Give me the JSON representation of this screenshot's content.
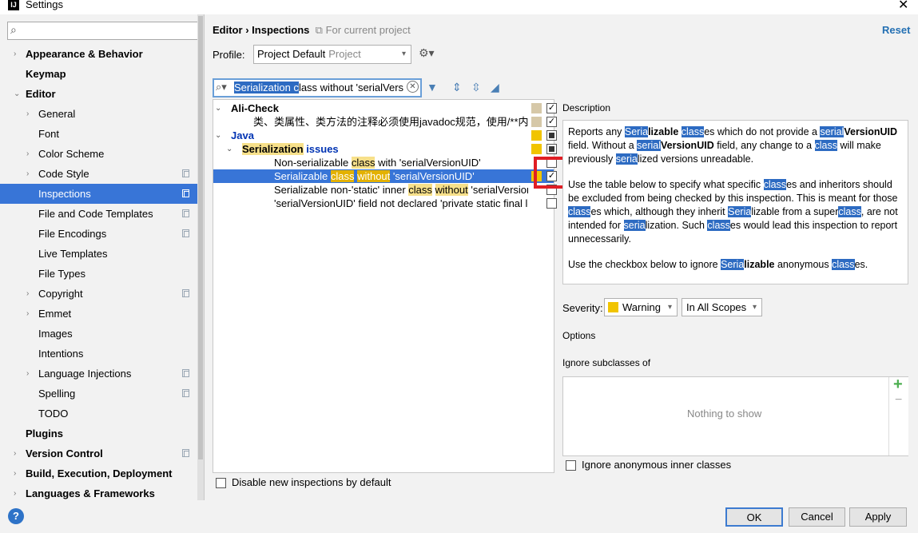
{
  "window": {
    "title": "Settings",
    "app_icon": "intellij-icon"
  },
  "sidebar": {
    "search_placeholder": "",
    "items": [
      {
        "label": "Appearance & Behavior",
        "level": 0,
        "arrow": true,
        "bold": true
      },
      {
        "label": "Keymap",
        "level": 0,
        "arrow": false,
        "bold": true
      },
      {
        "label": "Editor",
        "level": 0,
        "arrow": true,
        "expanded": true,
        "bold": true
      },
      {
        "label": "General",
        "level": 1,
        "arrow": true
      },
      {
        "label": "Font",
        "level": 1
      },
      {
        "label": "Color Scheme",
        "level": 1,
        "arrow": true
      },
      {
        "label": "Code Style",
        "level": 1,
        "arrow": true,
        "copy": true
      },
      {
        "label": "Inspections",
        "level": 1,
        "copy": true,
        "selected": true
      },
      {
        "label": "File and Code Templates",
        "level": 1,
        "copy": true
      },
      {
        "label": "File Encodings",
        "level": 1,
        "copy": true
      },
      {
        "label": "Live Templates",
        "level": 1
      },
      {
        "label": "File Types",
        "level": 1
      },
      {
        "label": "Copyright",
        "level": 1,
        "arrow": true,
        "copy": true
      },
      {
        "label": "Emmet",
        "level": 1,
        "arrow": true
      },
      {
        "label": "Images",
        "level": 1
      },
      {
        "label": "Intentions",
        "level": 1
      },
      {
        "label": "Language Injections",
        "level": 1,
        "arrow": true,
        "copy": true
      },
      {
        "label": "Spelling",
        "level": 1,
        "copy": true
      },
      {
        "label": "TODO",
        "level": 1
      },
      {
        "label": "Plugins",
        "level": 0,
        "bold": true
      },
      {
        "label": "Version Control",
        "level": 0,
        "arrow": true,
        "bold": true,
        "copy": true
      },
      {
        "label": "Build, Execution, Deployment",
        "level": 0,
        "arrow": true,
        "bold": true
      },
      {
        "label": "Languages & Frameworks",
        "level": 0,
        "arrow": true,
        "bold": true
      }
    ]
  },
  "header": {
    "crumb1": "Editor",
    "sep": "›",
    "crumb2": "Inspections",
    "scope_note": "For current project",
    "reset_label": "Reset"
  },
  "profile": {
    "label": "Profile:",
    "value": "Project Default",
    "hint": "Project"
  },
  "filter": {
    "value_highlight": "Serialization c",
    "value_rest": "lass without 'serialVers"
  },
  "inspections": [
    {
      "parts": [
        [
          "Ali-Check",
          false
        ]
      ],
      "level": 0,
      "arrow": true,
      "bold": true,
      "sev": "#d6c8a8",
      "check": "checked"
    },
    {
      "parts": [
        [
          "类、类属性、类方法的注释必须使用javadoc规范，使用/**内容*/格式",
          false
        ]
      ],
      "level": 2,
      "sev": "#d6c8a8",
      "check": "checked"
    },
    {
      "parts": [
        [
          "Java",
          false
        ]
      ],
      "level": 0,
      "arrow": true,
      "bold": true,
      "blue": true,
      "sev": "#f1c400",
      "check": "mixed"
    },
    {
      "parts": [
        [
          "Serialization",
          true
        ],
        [
          " issues",
          false
        ]
      ],
      "level": 1,
      "arrow": true,
      "bold": true,
      "blue": true,
      "sev": "#f1c400",
      "check": "mixed"
    },
    {
      "parts": [
        [
          "Non-serializable ",
          false
        ],
        [
          "class",
          true
        ],
        [
          " with 'serialVersionUID'",
          false
        ]
      ],
      "level": 3,
      "check": "empty"
    },
    {
      "parts": [
        [
          "Serializable ",
          false
        ],
        [
          "class",
          true
        ],
        [
          " ",
          false
        ],
        [
          "without",
          true
        ],
        [
          " 'serialVersionUID'",
          false
        ]
      ],
      "level": 3,
      "selected": true,
      "sev": "#f1c400",
      "check": "checked"
    },
    {
      "parts": [
        [
          "Serializable non-'static' inner ",
          false
        ],
        [
          "class",
          true
        ],
        [
          " ",
          false
        ],
        [
          "without",
          true
        ],
        [
          " 'serialVersionUID'",
          false
        ]
      ],
      "level": 3,
      "check": "empty"
    },
    {
      "parts": [
        [
          "'serialVersionUID' field not declared 'private static final long'",
          false
        ]
      ],
      "level": 3,
      "check": "empty"
    }
  ],
  "disable_new_label": "Disable new inspections by default",
  "description": {
    "label": "Description",
    "p1": [
      [
        "Reports any ",
        0
      ],
      [
        "Seria",
        1
      ],
      [
        "lizable ",
        2
      ],
      [
        "class",
        1
      ],
      [
        "es which do not provide a ",
        0
      ],
      [
        "serial",
        1
      ],
      [
        "VersionUID",
        2
      ],
      [
        " field. Without a ",
        0
      ],
      [
        "serial",
        1
      ],
      [
        "VersionUID",
        2
      ],
      [
        " field, any change to a ",
        0
      ],
      [
        "class",
        1
      ],
      [
        " will make previously ",
        0
      ],
      [
        "seria",
        1
      ],
      [
        "lized versions unreadable.",
        0
      ]
    ],
    "p2": [
      [
        "Use the table below to specify what specific ",
        0
      ],
      [
        "class",
        1
      ],
      [
        "es and inheritors should be excluded from being checked by this inspection. This is meant for those ",
        0
      ],
      [
        "class",
        1
      ],
      [
        "es which, although they inherit ",
        0
      ],
      [
        "Seria",
        1
      ],
      [
        "lizable from a super",
        0
      ],
      [
        "class",
        1
      ],
      [
        ", are not intended for ",
        0
      ],
      [
        "seria",
        1
      ],
      [
        "lization. Such ",
        0
      ],
      [
        "class",
        1
      ],
      [
        "es would lead this inspection to report unnecessarily.",
        0
      ]
    ],
    "p3": [
      [
        "Use the checkbox below to ignore ",
        0
      ],
      [
        "Seria",
        1
      ],
      [
        "lizable",
        2
      ],
      [
        " anonymous ",
        0
      ],
      [
        "class",
        1
      ],
      [
        "es.",
        0
      ]
    ]
  },
  "severity": {
    "label": "Severity:",
    "value": "Warning",
    "color": "#f1c400",
    "scope": "In All Scopes"
  },
  "options_label": "Options",
  "ignore": {
    "label": "Ignore subclasses of",
    "empty": "Nothing to show",
    "add": "+",
    "remove": "−"
  },
  "ignore_anon_label": "Ignore anonymous inner classes",
  "buttons": {
    "help": "?",
    "ok": "OK",
    "cancel": "Cancel",
    "apply": "Apply"
  },
  "accent": "#3875d7"
}
